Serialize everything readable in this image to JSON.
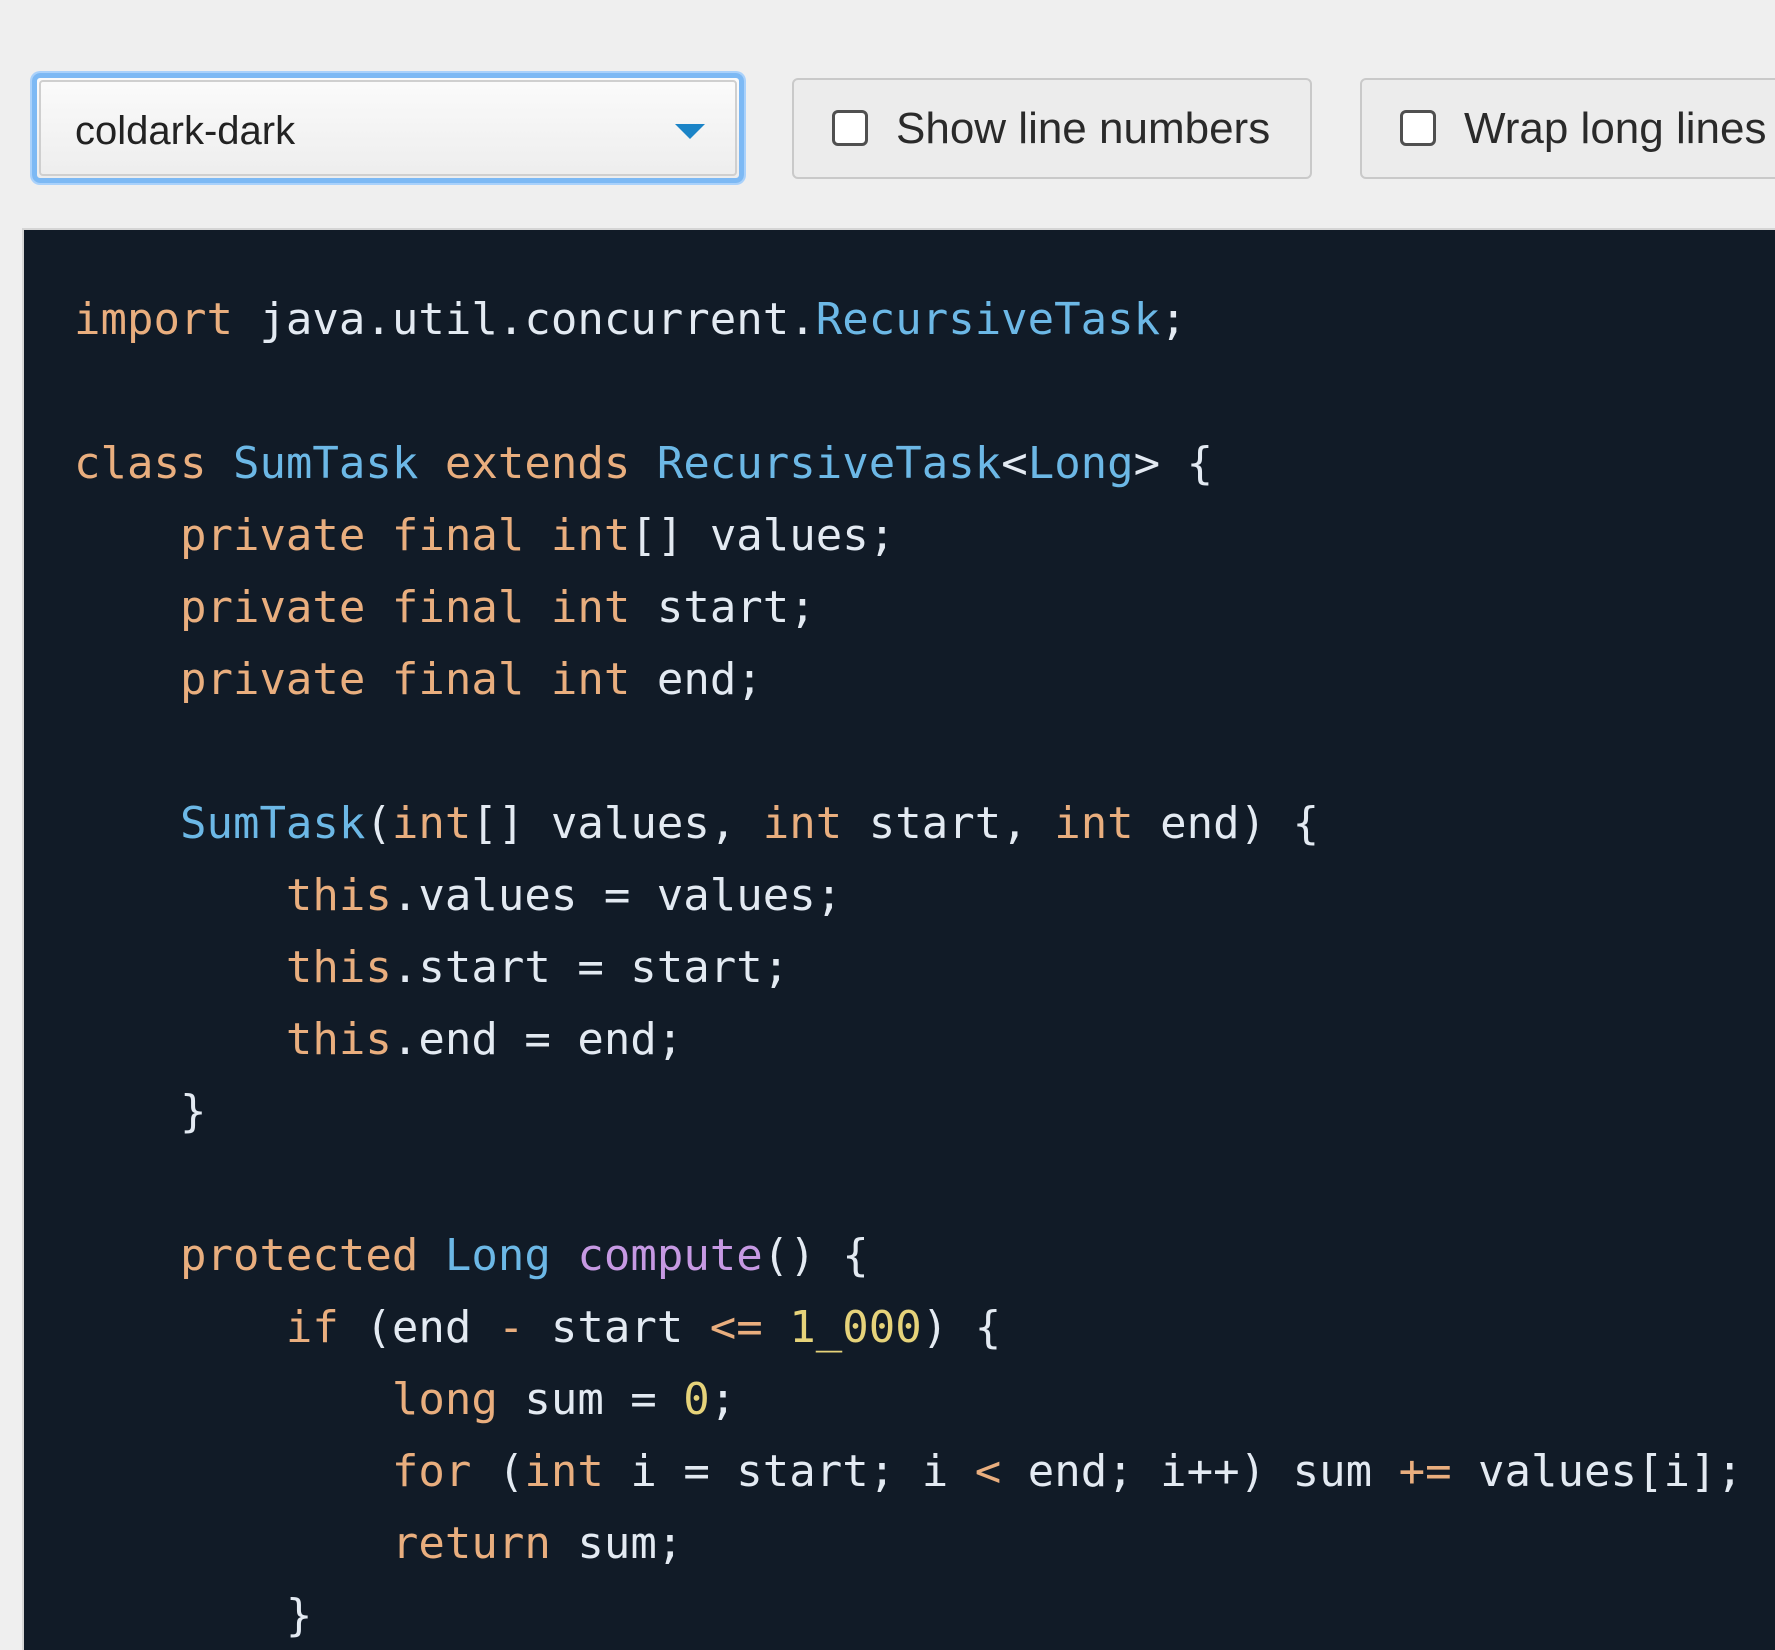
{
  "controls": {
    "theme_value": "coldark-dark",
    "show_line_numbers_label": "Show line numbers",
    "wrap_long_lines_label": "Wrap long lines"
  },
  "colors": {
    "editor_background": "#111b27",
    "keyword": "#e9ae7e",
    "class_name": "#6cb8e6",
    "function": "#c699e3",
    "number": "#e6d37a",
    "plain_text": "#e3eaf2",
    "select_focus": "#7db9f4",
    "dropdown_arrow": "#1b84c7"
  },
  "code": {
    "language": "java",
    "lines": [
      [
        [
          "keyword",
          "import"
        ],
        [
          "plain",
          " java.util.concurrent."
        ],
        [
          "class",
          "RecursiveTask"
        ],
        [
          "plain",
          ";"
        ]
      ],
      [],
      [
        [
          "keyword",
          "class"
        ],
        [
          "plain",
          " "
        ],
        [
          "class",
          "SumTask"
        ],
        [
          "plain",
          " "
        ],
        [
          "keyword",
          "extends"
        ],
        [
          "plain",
          " "
        ],
        [
          "class",
          "RecursiveTask"
        ],
        [
          "plain",
          "<"
        ],
        [
          "class",
          "Long"
        ],
        [
          "plain",
          "> {"
        ]
      ],
      [
        [
          "plain",
          "    "
        ],
        [
          "keyword",
          "private"
        ],
        [
          "plain",
          " "
        ],
        [
          "keyword",
          "final"
        ],
        [
          "plain",
          " "
        ],
        [
          "keyword",
          "int"
        ],
        [
          "plain",
          "[] values;"
        ]
      ],
      [
        [
          "plain",
          "    "
        ],
        [
          "keyword",
          "private"
        ],
        [
          "plain",
          " "
        ],
        [
          "keyword",
          "final"
        ],
        [
          "plain",
          " "
        ],
        [
          "keyword",
          "int"
        ],
        [
          "plain",
          " start;"
        ]
      ],
      [
        [
          "plain",
          "    "
        ],
        [
          "keyword",
          "private"
        ],
        [
          "plain",
          " "
        ],
        [
          "keyword",
          "final"
        ],
        [
          "plain",
          " "
        ],
        [
          "keyword",
          "int"
        ],
        [
          "plain",
          " end;"
        ]
      ],
      [],
      [
        [
          "plain",
          "    "
        ],
        [
          "class",
          "SumTask"
        ],
        [
          "plain",
          "("
        ],
        [
          "keyword",
          "int"
        ],
        [
          "plain",
          "[] values, "
        ],
        [
          "keyword",
          "int"
        ],
        [
          "plain",
          " start, "
        ],
        [
          "keyword",
          "int"
        ],
        [
          "plain",
          " end) {"
        ]
      ],
      [
        [
          "plain",
          "        "
        ],
        [
          "keyword",
          "this"
        ],
        [
          "plain",
          ".values = values;"
        ]
      ],
      [
        [
          "plain",
          "        "
        ],
        [
          "keyword",
          "this"
        ],
        [
          "plain",
          ".start = start;"
        ]
      ],
      [
        [
          "plain",
          "        "
        ],
        [
          "keyword",
          "this"
        ],
        [
          "plain",
          ".end = end;"
        ]
      ],
      [
        [
          "plain",
          "    }"
        ]
      ],
      [],
      [
        [
          "plain",
          "    "
        ],
        [
          "keyword",
          "protected"
        ],
        [
          "plain",
          " "
        ],
        [
          "class",
          "Long"
        ],
        [
          "plain",
          " "
        ],
        [
          "function",
          "compute"
        ],
        [
          "plain",
          "() {"
        ]
      ],
      [
        [
          "plain",
          "        "
        ],
        [
          "keyword",
          "if"
        ],
        [
          "plain",
          " (end "
        ],
        [
          "operator",
          "-"
        ],
        [
          "plain",
          " start "
        ],
        [
          "operator",
          "<="
        ],
        [
          "plain",
          " "
        ],
        [
          "number",
          "1_000"
        ],
        [
          "plain",
          ") {"
        ]
      ],
      [
        [
          "plain",
          "            "
        ],
        [
          "keyword",
          "long"
        ],
        [
          "plain",
          " sum = "
        ],
        [
          "number",
          "0"
        ],
        [
          "plain",
          ";"
        ]
      ],
      [
        [
          "plain",
          "            "
        ],
        [
          "keyword",
          "for"
        ],
        [
          "plain",
          " ("
        ],
        [
          "keyword",
          "int"
        ],
        [
          "plain",
          " i = start; i "
        ],
        [
          "operator",
          "<"
        ],
        [
          "plain",
          " end; i++) sum "
        ],
        [
          "operator",
          "+="
        ],
        [
          "plain",
          " values[i];"
        ]
      ],
      [
        [
          "plain",
          "            "
        ],
        [
          "keyword",
          "return"
        ],
        [
          "plain",
          " sum;"
        ]
      ],
      [
        [
          "plain",
          "        }"
        ]
      ]
    ]
  }
}
